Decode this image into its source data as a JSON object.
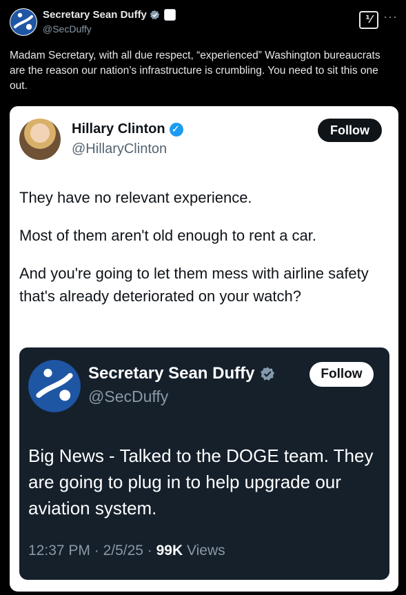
{
  "post": {
    "author_name": "Secretary Sean Duffy",
    "author_handle": "@SecDuffy",
    "text": "Madam Secretary, with all due respect, “experienced” Washington bureaucrats are the reason our nation’s infrastructure is crumbling. You need to sit this one out."
  },
  "quoted": {
    "author_name": "Hillary Clinton",
    "author_handle": "@HillaryClinton",
    "follow_label": "Follow",
    "paragraphs": [
      "They have no relevant experience.",
      "Most of them aren't old enough to rent a car.",
      "And you're going to let them mess with airline safety that's already deteriorated on your watch?"
    ]
  },
  "nested": {
    "author_name": "Secretary Sean Duffy",
    "author_handle": "@SecDuffy",
    "follow_label": "Follow",
    "text": "Big News - Talked to the DOGE team. They are going to plug in to help upgrade our aviation system.",
    "time": "12:37 PM",
    "date": "2/5/25",
    "views_count": "99K",
    "views_label": "Views"
  },
  "icons": {
    "grok": "grok-icon",
    "more": "more-icon",
    "verified_gray": "gray-verified-icon",
    "verified_blue": "blue-verified-icon",
    "gov_flag": "government-flag-icon"
  },
  "colors": {
    "background": "#000000",
    "text_primary": "#e7e9ea",
    "text_secondary": "#8b98a5",
    "blue_check": "#1d9bf0",
    "nested_card": "#15202b"
  }
}
